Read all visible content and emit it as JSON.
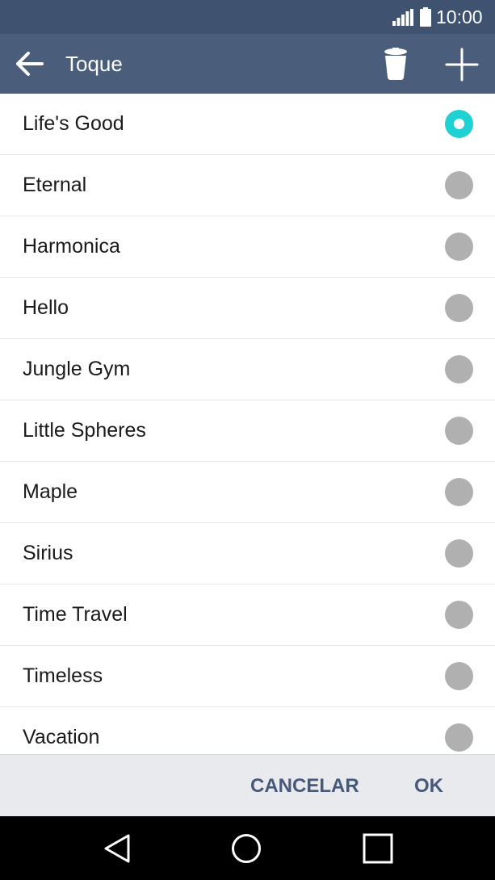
{
  "status_bar": {
    "time": "10:00",
    "icons": [
      "signal-icon",
      "battery-icon"
    ]
  },
  "action_bar": {
    "title": "Toque",
    "icons": [
      "back-arrow-icon",
      "trash-icon",
      "plus-icon"
    ]
  },
  "ringtones": [
    {
      "label": "Life's Good",
      "selected": true
    },
    {
      "label": "Eternal",
      "selected": false
    },
    {
      "label": "Harmonica",
      "selected": false
    },
    {
      "label": "Hello",
      "selected": false
    },
    {
      "label": "Jungle Gym",
      "selected": false
    },
    {
      "label": "Little Spheres",
      "selected": false
    },
    {
      "label": "Maple",
      "selected": false
    },
    {
      "label": "Sirius",
      "selected": false
    },
    {
      "label": "Time Travel",
      "selected": false
    },
    {
      "label": "Timeless",
      "selected": false
    },
    {
      "label": "Vacation",
      "selected": false
    }
  ],
  "buttons": {
    "cancel": "CANCELAR",
    "ok": "OK"
  },
  "nav_bar": {
    "icons": [
      "back-triangle-icon",
      "home-circle-icon",
      "recent-apps-square-icon"
    ]
  },
  "colors": {
    "status_bar_bg": "#3f5370",
    "action_bar_bg": "#4a5e7c",
    "radio_selected": "#1fd1d3",
    "radio_unselected": "#b0b0b0",
    "button_text": "#47597a",
    "button_bar_bg": "#e8eaed"
  }
}
